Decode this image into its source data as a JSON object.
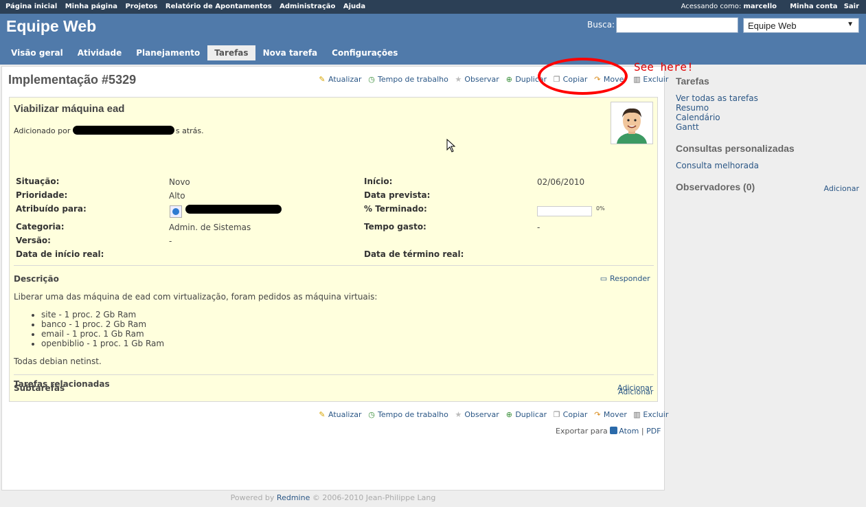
{
  "top_menu": {
    "items": [
      "Página inicial",
      "Minha página",
      "Projetos",
      "Relatório de Apontamentos",
      "Administração",
      "Ajuda"
    ],
    "logged_as_label": "Acessando como:",
    "user": "marcello",
    "my_account": "Minha conta",
    "logout": "Sair"
  },
  "header": {
    "title": "Equipe Web",
    "search_label": "Busca:",
    "project_select": "Equipe Web",
    "tabs": [
      "Visão geral",
      "Atividade",
      "Planejamento",
      "Tarefas",
      "Nova tarefa",
      "Configurações"
    ],
    "selected_tab": "Tarefas"
  },
  "issue": {
    "heading": "Implementação #5329",
    "actions": {
      "update": "Atualizar",
      "log_time": "Tempo de trabalho",
      "watch": "Observar",
      "duplicate": "Duplicar",
      "copy": "Copiar",
      "move": "Mover",
      "delete": "Excluir"
    },
    "subject": "Viabilizar máquina ead",
    "added_by": "Adicionado por",
    "added_suffix": "s atrás.",
    "attributes": {
      "status_label": "Situação:",
      "status": "Novo",
      "priority_label": "Prioridade:",
      "priority": "Alto",
      "assigned_label": "Atribuído para:",
      "category_label": "Categoria:",
      "category": "Admin. de Sistemas",
      "version_label": "Versão:",
      "version": "-",
      "actual_start_label": "Data de início real:",
      "start_label": "Início:",
      "start": "02/06/2010",
      "due_label": "Data prevista:",
      "done_label": "% Terminado:",
      "done_percent": "0%",
      "done_value": 0,
      "spent_label": "Tempo gasto:",
      "spent": "-",
      "actual_end_label": "Data de término real:"
    },
    "description_title": "Descrição",
    "reply": "Responder",
    "description_intro": "Liberar uma das máquina de ead com virtualização, foram pedidos as máquina virtuais:",
    "description_items": [
      "site - 1 proc. 2 Gb Ram",
      "banco - 1 proc. 2 Gb Ram",
      "email - 1 proc. 1 Gb Ram",
      "openbiblio - 1 proc. 1 Gb Ram"
    ],
    "description_outro": "Todas debian netinst.",
    "subtasks_title": "Subtarefas",
    "related_title": "Tarefas relacionadas",
    "add": "Adicionar",
    "export_label": "Exportar para",
    "export_atom": "Atom",
    "export_sep": "|",
    "export_pdf": "PDF"
  },
  "annotation": {
    "text": "See here!",
    "color": "#ff0000"
  },
  "sidebar": {
    "issues_title": "Tarefas",
    "issues_links": [
      "Ver todas as tarefas",
      "Resumo",
      "Calendário",
      "Gantt"
    ],
    "queries_title": "Consultas personalizadas",
    "queries_links": [
      "Consulta melhorada"
    ],
    "watchers_title": "Observadores (0)",
    "watchers_add": "Adicionar"
  },
  "footer": {
    "powered": "Powered by",
    "redmine": "Redmine",
    "copyright": "© 2006-2010 Jean-Philippe Lang"
  },
  "colors": {
    "top_menu": "#2c4056",
    "header": "#507aaa",
    "issue_bg": "#ffffdd",
    "link": "#2a5685"
  }
}
